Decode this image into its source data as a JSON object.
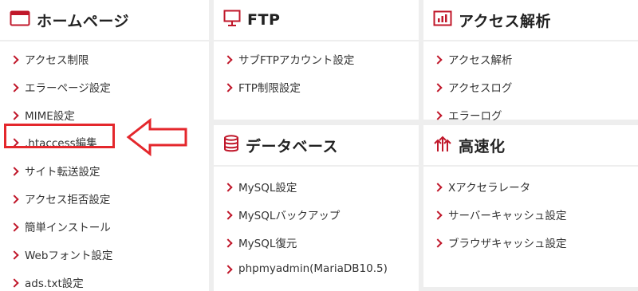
{
  "homepage": {
    "title": "ホームページ",
    "items": [
      "アクセス制限",
      "エラーページ設定",
      "MIME設定",
      ".htaccess編集",
      "サイト転送設定",
      "アクセス拒否設定",
      "簡単インストール",
      "Webフォント設定",
      "ads.txt設定"
    ]
  },
  "ftp": {
    "title": "FTP",
    "items": [
      "サブFTPアカウント設定",
      "FTP制限設定"
    ]
  },
  "analytics": {
    "title": "アクセス解析",
    "items": [
      "アクセス解析",
      "アクセスログ",
      "エラーログ"
    ]
  },
  "database": {
    "title": "データベース",
    "items": [
      "MySQL設定",
      "MySQLバックアップ",
      "MySQL復元",
      "phpmyadmin(MariaDB10.5)"
    ]
  },
  "speed": {
    "title": "高速化",
    "items": [
      "Xアクセラレータ",
      "サーバーキャッシュ設定",
      "ブラウザキャッシュ設定"
    ]
  },
  "colors": {
    "accent": "#c0172a",
    "highlight": "#e4272c"
  },
  "icons": {
    "homepage": "browser-window-icon",
    "ftp": "monitor-icon",
    "analytics": "bar-chart-icon",
    "database": "database-icon",
    "speed": "speed-arrows-icon",
    "pointer": "left-arrow-icon"
  }
}
